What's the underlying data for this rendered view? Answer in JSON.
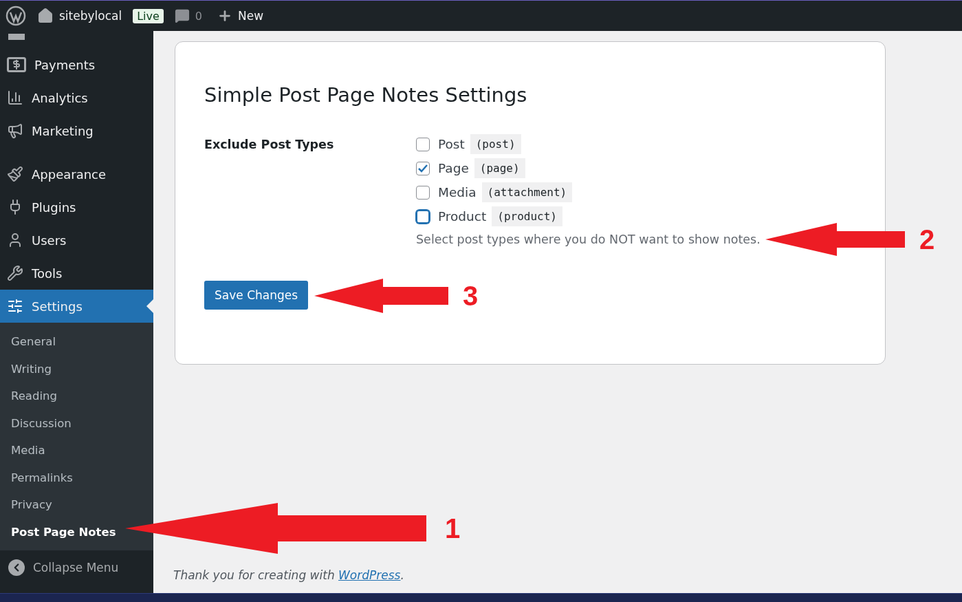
{
  "admin_bar": {
    "site_name": "sitebylocal",
    "live_badge": "Live",
    "comments_count": "0",
    "new_label": "New"
  },
  "sidebar": {
    "items": [
      {
        "label": "Payments",
        "selected": false
      },
      {
        "label": "Analytics",
        "selected": false
      },
      {
        "label": "Marketing",
        "selected": false
      },
      {
        "label": "Appearance",
        "selected": false
      },
      {
        "label": "Plugins",
        "selected": false
      },
      {
        "label": "Users",
        "selected": false
      },
      {
        "label": "Tools",
        "selected": false
      },
      {
        "label": "Settings",
        "selected": true
      }
    ],
    "submenu": [
      {
        "label": "General",
        "selected": false
      },
      {
        "label": "Writing",
        "selected": false
      },
      {
        "label": "Reading",
        "selected": false
      },
      {
        "label": "Discussion",
        "selected": false
      },
      {
        "label": "Media",
        "selected": false
      },
      {
        "label": "Permalinks",
        "selected": false
      },
      {
        "label": "Privacy",
        "selected": false
      },
      {
        "label": "Post Page Notes",
        "selected": true
      }
    ],
    "collapse_label": "Collapse Menu"
  },
  "settings": {
    "title": "Simple Post Page Notes Settings",
    "field_label": "Exclude Post Types",
    "options": [
      {
        "label": "Post",
        "slug": "(post)",
        "checked": false,
        "focused": false
      },
      {
        "label": "Page",
        "slug": "(page)",
        "checked": true,
        "focused": false
      },
      {
        "label": "Media",
        "slug": "(attachment)",
        "checked": false,
        "focused": false
      },
      {
        "label": "Product",
        "slug": "(product)",
        "checked": false,
        "focused": true
      }
    ],
    "description": "Select post types where you do NOT want to show notes.",
    "save_button": "Save Changes"
  },
  "footer": {
    "text": "Thank you for creating with ",
    "link": "WordPress",
    "tail": "."
  },
  "annotations": [
    "1",
    "2",
    "3"
  ]
}
